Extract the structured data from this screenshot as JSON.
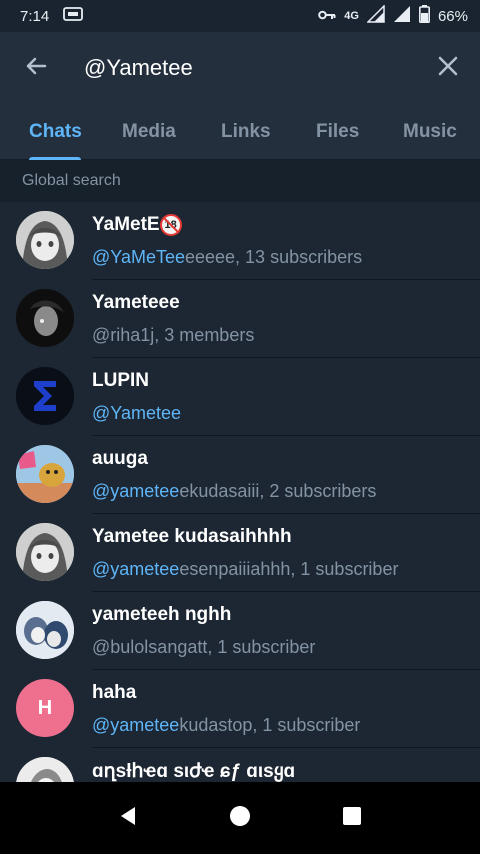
{
  "status_bar": {
    "time": "7:14",
    "network": "4G",
    "battery": "66%"
  },
  "search": {
    "query": "@Yametee",
    "icons": {
      "back": "arrow-left-icon",
      "clear": "close-icon"
    }
  },
  "tabs": [
    {
      "label": "Chats",
      "active": true
    },
    {
      "label": "Media",
      "active": false
    },
    {
      "label": "Links",
      "active": false
    },
    {
      "label": "Files",
      "active": false
    },
    {
      "label": "Music",
      "active": false
    }
  ],
  "section_header": "Global search",
  "results": [
    {
      "name": "YaMetE",
      "name_badge": "18",
      "sub_highlight": "@YaMeTee",
      "sub_rest": "eeeee, 13 subscribers"
    },
    {
      "name": "Yameteee",
      "sub_highlight": "",
      "sub_rest": "@riha1j, 3 members"
    },
    {
      "name": "LUPIN",
      "sub_highlight": "@Yametee",
      "sub_rest": ""
    },
    {
      "name": "auuga",
      "sub_highlight": "@yametee",
      "sub_rest": "ekudasaiii, 2 subscribers"
    },
    {
      "name": "Yametee kudasaihhhh",
      "sub_highlight": "@yametee",
      "sub_rest": "esenpaiiiahhh, 1 subscriber"
    },
    {
      "name": "yameteeh nghh",
      "sub_highlight": "",
      "sub_rest": "@bulolsangatt, 1 subscriber"
    },
    {
      "name": "haha",
      "avatar_letter": "H",
      "sub_highlight": "@yametee",
      "sub_rest": "kudastop, 1 subscriber"
    },
    {
      "name": "ɑղѕƚհҽɑ ѕιժҽ ɕƒ ɑιѕყɑ",
      "sub_highlight": "",
      "sub_rest": ""
    }
  ],
  "colors": {
    "background": "#1d2733",
    "header": "#242f3d",
    "accent": "#5eb5f7",
    "secondary_text": "#8393a3",
    "haha_avatar": "#ef6f8f"
  }
}
